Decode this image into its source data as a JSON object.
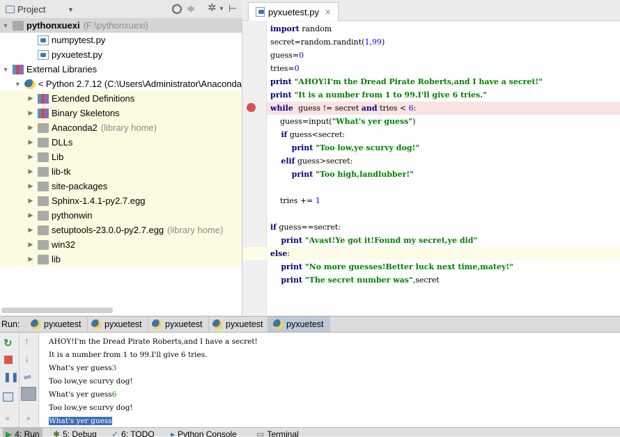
{
  "project_panel": {
    "title": "Project",
    "tree": [
      {
        "label": "pythonxuexi",
        "dim": "(F:\\pythonxuexi)",
        "indent": 0,
        "arrow": "▼",
        "icon": "folder",
        "bold": true,
        "selected": true
      },
      {
        "label": "numpytest.py",
        "dim": "",
        "indent": 2,
        "arrow": "",
        "icon": "pyfile"
      },
      {
        "label": "pyxuetest.py",
        "dim": "",
        "indent": 2,
        "arrow": "",
        "icon": "pyfile"
      },
      {
        "label": "External Libraries",
        "dim": "",
        "indent": 0,
        "arrow": "▼",
        "icon": "barico"
      },
      {
        "label": "< Python 2.7.12 (C:\\Users\\Administrator\\Anaconda",
        "dim": "",
        "indent": 1,
        "arrow": "▼",
        "icon": "pyico"
      },
      {
        "label": "Extended Definitions",
        "dim": "",
        "indent": 2,
        "arrow": "▶",
        "icon": "barico",
        "lib": true
      },
      {
        "label": "Binary Skeletons",
        "dim": "",
        "indent": 2,
        "arrow": "▶",
        "icon": "barico",
        "lib": true
      },
      {
        "label": "Anaconda2",
        "dim": "(library home)",
        "indent": 2,
        "arrow": "▶",
        "icon": "folder",
        "lib": true
      },
      {
        "label": "DLLs",
        "dim": "",
        "indent": 2,
        "arrow": "▶",
        "icon": "folder",
        "lib": true
      },
      {
        "label": "Lib",
        "dim": "",
        "indent": 2,
        "arrow": "▶",
        "icon": "folder",
        "lib": true
      },
      {
        "label": "lib-tk",
        "dim": "",
        "indent": 2,
        "arrow": "▶",
        "icon": "folder",
        "lib": true
      },
      {
        "label": "site-packages",
        "dim": "",
        "indent": 2,
        "arrow": "▶",
        "icon": "folder",
        "lib": true
      },
      {
        "label": "Sphinx-1.4.1-py2.7.egg",
        "dim": "",
        "indent": 2,
        "arrow": "▶",
        "icon": "folder",
        "lib": true
      },
      {
        "label": "pythonwin",
        "dim": "",
        "indent": 2,
        "arrow": "▶",
        "icon": "folder",
        "lib": true
      },
      {
        "label": "setuptools-23.0.0-py2.7.egg",
        "dim": "(library home)",
        "indent": 2,
        "arrow": "▶",
        "icon": "folder",
        "lib": true
      },
      {
        "label": "win32",
        "dim": "",
        "indent": 2,
        "arrow": "▶",
        "icon": "folder",
        "lib": true
      },
      {
        "label": "lib",
        "dim": "",
        "indent": 2,
        "arrow": "▶",
        "icon": "folder",
        "lib": true
      }
    ]
  },
  "editor": {
    "tab_label": "pyxuetest.py",
    "lines": [
      [
        [
          "kw",
          "import"
        ],
        [
          "t",
          " random"
        ]
      ],
      [
        [
          "t",
          "secret=random.randint("
        ],
        [
          "num",
          "1"
        ],
        [
          "t",
          ","
        ],
        [
          "num",
          "99"
        ],
        [
          "t",
          ")"
        ]
      ],
      [
        [
          "t",
          "guess="
        ],
        [
          "num",
          "0"
        ]
      ],
      [
        [
          "t",
          "tries="
        ],
        [
          "num",
          "0"
        ]
      ],
      [
        [
          "kw",
          "print "
        ],
        [
          "str",
          "\"AHOY!I'm the Dread Pirate Roberts,and I have a secret!\""
        ]
      ],
      [
        [
          "kw",
          "print "
        ],
        [
          "str",
          "\"It is a number from 1 to 99.I'll give 6 tries.\""
        ]
      ],
      [
        [
          "kw",
          "while "
        ],
        [
          "t",
          " guess != secret "
        ],
        [
          "kw",
          "and"
        ],
        [
          "t",
          " tries < "
        ],
        [
          "num",
          "6"
        ],
        [
          "t",
          ":"
        ]
      ],
      [
        [
          "t",
          "    guess=input("
        ],
        [
          "str",
          "\"What's yer guess\""
        ],
        [
          "t",
          ")"
        ]
      ],
      [
        [
          "kw",
          "    if"
        ],
        [
          "t",
          " guess<secret:"
        ]
      ],
      [
        [
          "kw",
          "        print "
        ],
        [
          "str",
          "\"Too low,ye scurvy dog!\""
        ]
      ],
      [
        [
          "kw",
          "    elif"
        ],
        [
          "t",
          " guess>secret:"
        ]
      ],
      [
        [
          "kw",
          "        print "
        ],
        [
          "str",
          "\"Too high,landlubber!\""
        ]
      ],
      [
        [
          "t",
          ""
        ]
      ],
      [
        [
          "t",
          "    tries += "
        ],
        [
          "num",
          "1"
        ]
      ],
      [
        [
          "t",
          ""
        ]
      ],
      [
        [
          "kw",
          "if"
        ],
        [
          "t",
          " guess==secret:"
        ]
      ],
      [
        [
          "kw",
          "    print "
        ],
        [
          "str",
          "\"Avast!Ye got it!Found my secret,ye did\""
        ]
      ],
      [
        [
          "kw",
          "else"
        ],
        [
          "t",
          ":"
        ]
      ],
      [
        [
          "kw",
          "    print "
        ],
        [
          "str",
          "\"No more guesses!Better luck next time,matey!\""
        ]
      ],
      [
        [
          "kw",
          "    print "
        ],
        [
          "str",
          "\"The secret number was\""
        ],
        [
          "t",
          ",secret"
        ]
      ]
    ]
  },
  "run_panel": {
    "label": "Run:",
    "tabs": [
      "pyxuetest",
      "pyxuetest",
      "pyxuetest",
      "pyxuetest",
      "pyxuetest"
    ],
    "output": [
      {
        "text": "AHOY!I'm the Dread Pirate Roberts,and I have a secret!",
        "input": ""
      },
      {
        "text": "It is a number from 1 to 99.I'll give 6 tries.",
        "input": ""
      },
      {
        "text": "What's yer guess",
        "input": "3"
      },
      {
        "text": "Too low,ye scurvy dog!",
        "input": ""
      },
      {
        "text": "What's yer guess",
        "input": "6"
      },
      {
        "text": "Too low,ye scurvy dog!",
        "input": ""
      },
      {
        "text": "What's yer guess",
        "input": "",
        "selected": true
      }
    ]
  },
  "bottom_tabs": [
    {
      "label": "4: Run",
      "active": true
    },
    {
      "label": "5: Debug"
    },
    {
      "label": "6: TODO"
    },
    {
      "label": "Python Console"
    },
    {
      "label": "Terminal"
    }
  ],
  "colors": {
    "keyword": "#000080",
    "string": "#008000",
    "number": "#0000ff",
    "breakpoint": "#d9534f",
    "active_tab": "#bdc9d8"
  }
}
